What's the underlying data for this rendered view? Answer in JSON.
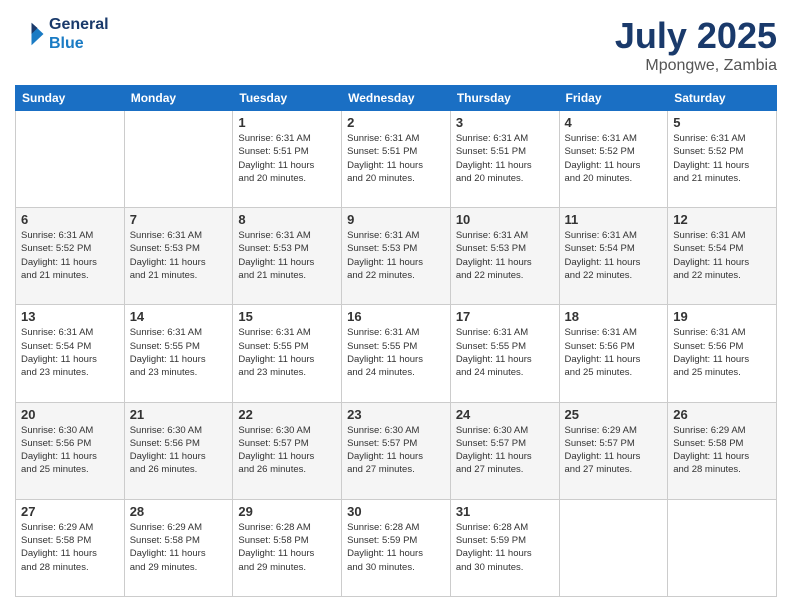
{
  "header": {
    "logo_line1": "General",
    "logo_line2": "Blue",
    "month": "July 2025",
    "location": "Mpongwe, Zambia"
  },
  "weekdays": [
    "Sunday",
    "Monday",
    "Tuesday",
    "Wednesday",
    "Thursday",
    "Friday",
    "Saturday"
  ],
  "weeks": [
    [
      {
        "day": "",
        "info": ""
      },
      {
        "day": "",
        "info": ""
      },
      {
        "day": "1",
        "info": "Sunrise: 6:31 AM\nSunset: 5:51 PM\nDaylight: 11 hours\nand 20 minutes."
      },
      {
        "day": "2",
        "info": "Sunrise: 6:31 AM\nSunset: 5:51 PM\nDaylight: 11 hours\nand 20 minutes."
      },
      {
        "day": "3",
        "info": "Sunrise: 6:31 AM\nSunset: 5:51 PM\nDaylight: 11 hours\nand 20 minutes."
      },
      {
        "day": "4",
        "info": "Sunrise: 6:31 AM\nSunset: 5:52 PM\nDaylight: 11 hours\nand 20 minutes."
      },
      {
        "day": "5",
        "info": "Sunrise: 6:31 AM\nSunset: 5:52 PM\nDaylight: 11 hours\nand 21 minutes."
      }
    ],
    [
      {
        "day": "6",
        "info": "Sunrise: 6:31 AM\nSunset: 5:52 PM\nDaylight: 11 hours\nand 21 minutes."
      },
      {
        "day": "7",
        "info": "Sunrise: 6:31 AM\nSunset: 5:53 PM\nDaylight: 11 hours\nand 21 minutes."
      },
      {
        "day": "8",
        "info": "Sunrise: 6:31 AM\nSunset: 5:53 PM\nDaylight: 11 hours\nand 21 minutes."
      },
      {
        "day": "9",
        "info": "Sunrise: 6:31 AM\nSunset: 5:53 PM\nDaylight: 11 hours\nand 22 minutes."
      },
      {
        "day": "10",
        "info": "Sunrise: 6:31 AM\nSunset: 5:53 PM\nDaylight: 11 hours\nand 22 minutes."
      },
      {
        "day": "11",
        "info": "Sunrise: 6:31 AM\nSunset: 5:54 PM\nDaylight: 11 hours\nand 22 minutes."
      },
      {
        "day": "12",
        "info": "Sunrise: 6:31 AM\nSunset: 5:54 PM\nDaylight: 11 hours\nand 22 minutes."
      }
    ],
    [
      {
        "day": "13",
        "info": "Sunrise: 6:31 AM\nSunset: 5:54 PM\nDaylight: 11 hours\nand 23 minutes."
      },
      {
        "day": "14",
        "info": "Sunrise: 6:31 AM\nSunset: 5:55 PM\nDaylight: 11 hours\nand 23 minutes."
      },
      {
        "day": "15",
        "info": "Sunrise: 6:31 AM\nSunset: 5:55 PM\nDaylight: 11 hours\nand 23 minutes."
      },
      {
        "day": "16",
        "info": "Sunrise: 6:31 AM\nSunset: 5:55 PM\nDaylight: 11 hours\nand 24 minutes."
      },
      {
        "day": "17",
        "info": "Sunrise: 6:31 AM\nSunset: 5:55 PM\nDaylight: 11 hours\nand 24 minutes."
      },
      {
        "day": "18",
        "info": "Sunrise: 6:31 AM\nSunset: 5:56 PM\nDaylight: 11 hours\nand 25 minutes."
      },
      {
        "day": "19",
        "info": "Sunrise: 6:31 AM\nSunset: 5:56 PM\nDaylight: 11 hours\nand 25 minutes."
      }
    ],
    [
      {
        "day": "20",
        "info": "Sunrise: 6:30 AM\nSunset: 5:56 PM\nDaylight: 11 hours\nand 25 minutes."
      },
      {
        "day": "21",
        "info": "Sunrise: 6:30 AM\nSunset: 5:56 PM\nDaylight: 11 hours\nand 26 minutes."
      },
      {
        "day": "22",
        "info": "Sunrise: 6:30 AM\nSunset: 5:57 PM\nDaylight: 11 hours\nand 26 minutes."
      },
      {
        "day": "23",
        "info": "Sunrise: 6:30 AM\nSunset: 5:57 PM\nDaylight: 11 hours\nand 27 minutes."
      },
      {
        "day": "24",
        "info": "Sunrise: 6:30 AM\nSunset: 5:57 PM\nDaylight: 11 hours\nand 27 minutes."
      },
      {
        "day": "25",
        "info": "Sunrise: 6:29 AM\nSunset: 5:57 PM\nDaylight: 11 hours\nand 27 minutes."
      },
      {
        "day": "26",
        "info": "Sunrise: 6:29 AM\nSunset: 5:58 PM\nDaylight: 11 hours\nand 28 minutes."
      }
    ],
    [
      {
        "day": "27",
        "info": "Sunrise: 6:29 AM\nSunset: 5:58 PM\nDaylight: 11 hours\nand 28 minutes."
      },
      {
        "day": "28",
        "info": "Sunrise: 6:29 AM\nSunset: 5:58 PM\nDaylight: 11 hours\nand 29 minutes."
      },
      {
        "day": "29",
        "info": "Sunrise: 6:28 AM\nSunset: 5:58 PM\nDaylight: 11 hours\nand 29 minutes."
      },
      {
        "day": "30",
        "info": "Sunrise: 6:28 AM\nSunset: 5:59 PM\nDaylight: 11 hours\nand 30 minutes."
      },
      {
        "day": "31",
        "info": "Sunrise: 6:28 AM\nSunset: 5:59 PM\nDaylight: 11 hours\nand 30 minutes."
      },
      {
        "day": "",
        "info": ""
      },
      {
        "day": "",
        "info": ""
      }
    ]
  ]
}
